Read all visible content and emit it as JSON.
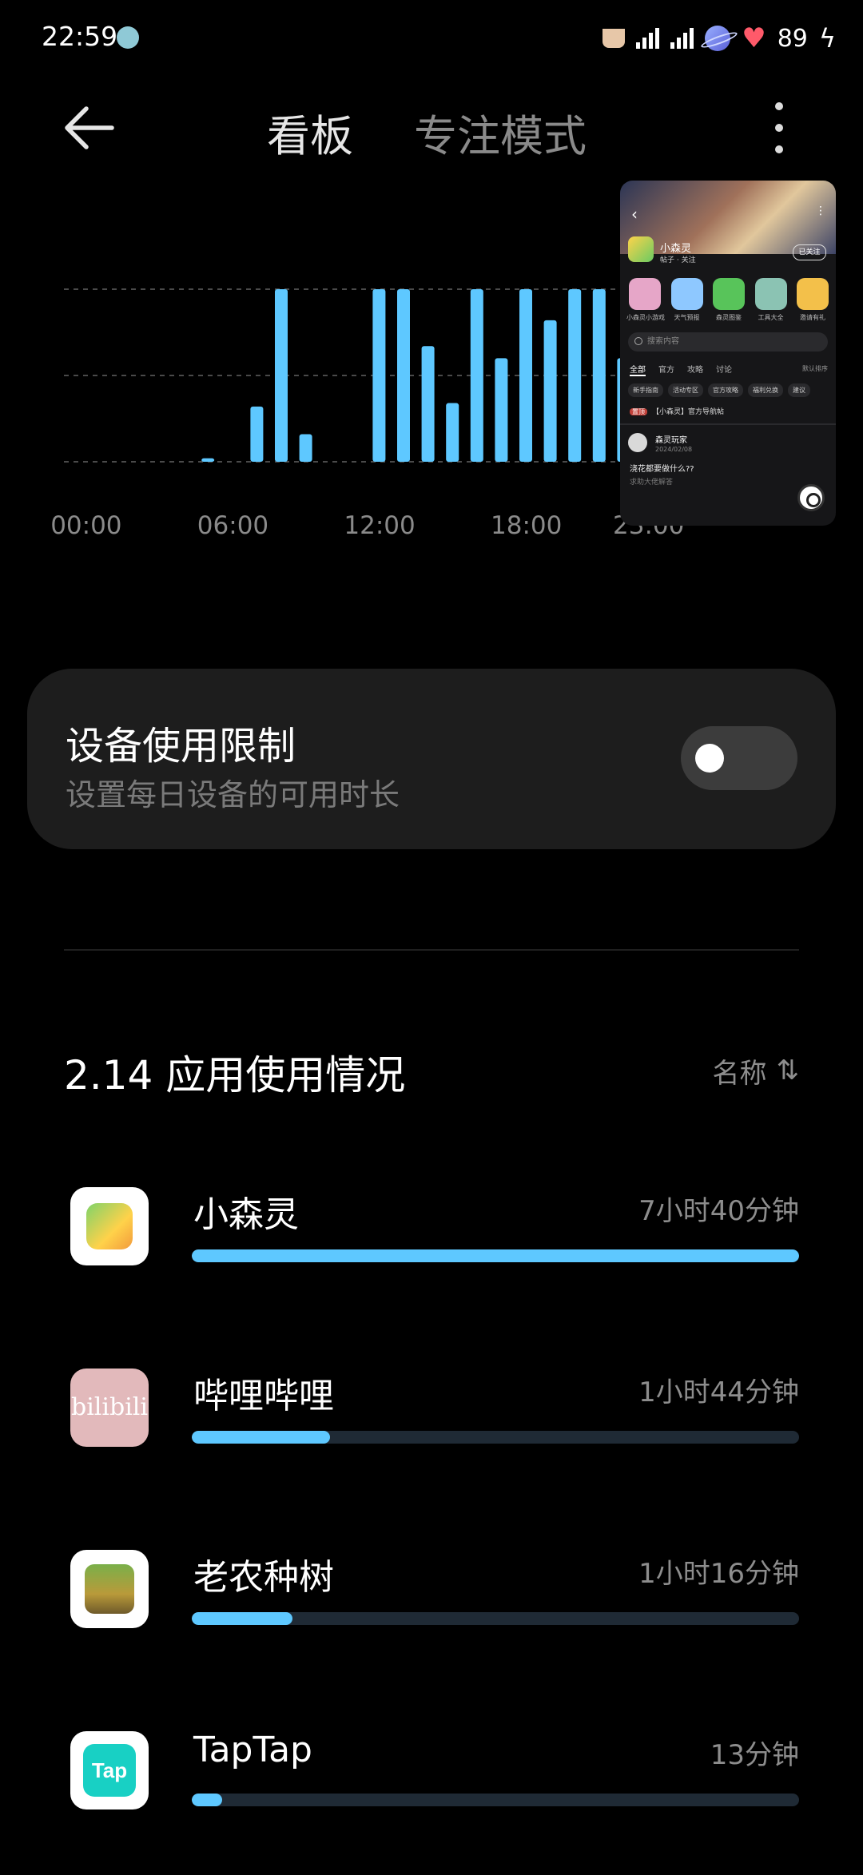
{
  "status_bar": {
    "time": "22:59",
    "battery_level": "89"
  },
  "header": {
    "tabs": [
      {
        "label": "看板",
        "active": true
      },
      {
        "label": "专注模式",
        "active": false
      }
    ]
  },
  "chart_data": {
    "type": "bar",
    "x_tick_labels": [
      "00:00",
      "06:00",
      "12:00",
      "18:00",
      "23:00"
    ],
    "bar_color": "#5ec8ff",
    "hours": [
      0,
      1,
      2,
      3,
      4,
      5,
      6,
      7,
      8,
      9,
      10,
      11,
      12,
      13,
      14,
      15,
      16,
      17,
      18,
      19,
      20,
      21,
      22,
      23
    ],
    "values": [
      0,
      0,
      0,
      0,
      0,
      0.02,
      0,
      0.32,
      1,
      0.16,
      0,
      0,
      1,
      1,
      0.67,
      0.34,
      1,
      0.6,
      1,
      0.82,
      1,
      1,
      0.6,
      0.25
    ],
    "ylim": [
      0,
      1
    ],
    "grid": true
  },
  "preview": {
    "title": "小森灵",
    "subtitle": "帖子 · 关注",
    "follow_label": "已关注",
    "apps": [
      {
        "label": "小森灵小游戏",
        "color": "#e6a6c8"
      },
      {
        "label": "天气预报",
        "color": "#8ec8ff"
      },
      {
        "label": "森灵图鉴",
        "color": "#58c45a"
      },
      {
        "label": "工具大全",
        "color": "#8bc3b3"
      },
      {
        "label": "邀请有礼",
        "color": "#f3c04a"
      }
    ],
    "search_placeholder": "搜索内容",
    "tabs": [
      "全部",
      "官方",
      "攻略",
      "讨论"
    ],
    "sort_label": "默认排序",
    "chips": [
      "新手指南",
      "活动专区",
      "官方攻略",
      "福利兑换",
      "建议"
    ],
    "pinned_tag": "置顶",
    "pinned_text": "【小森灵】官方导航帖",
    "author": "森灵玩家",
    "date": "2024/02/08",
    "question": "浇花都要做什么??",
    "answer": "求助大佬解答"
  },
  "limit_card": {
    "title": "设备使用限制",
    "subtitle": "设置每日设备的可用时长",
    "enabled": false
  },
  "usage_section": {
    "title": "2.14 应用使用情况",
    "sort_label": "名称",
    "sort_icon": "⇅"
  },
  "apps": [
    {
      "name": "小森灵",
      "time": "7小时40分钟",
      "fraction": 1.0
    },
    {
      "name": "哔哩哔哩",
      "time": "1小时44分钟",
      "fraction": 0.227
    },
    {
      "name": "老农种树",
      "time": "1小时16分钟",
      "fraction": 0.166
    },
    {
      "name": "TapTap",
      "time": "13分钟",
      "fraction": 0.05
    }
  ],
  "icon_text": {
    "bilibili": "bilibili",
    "taptap": "Tap"
  }
}
